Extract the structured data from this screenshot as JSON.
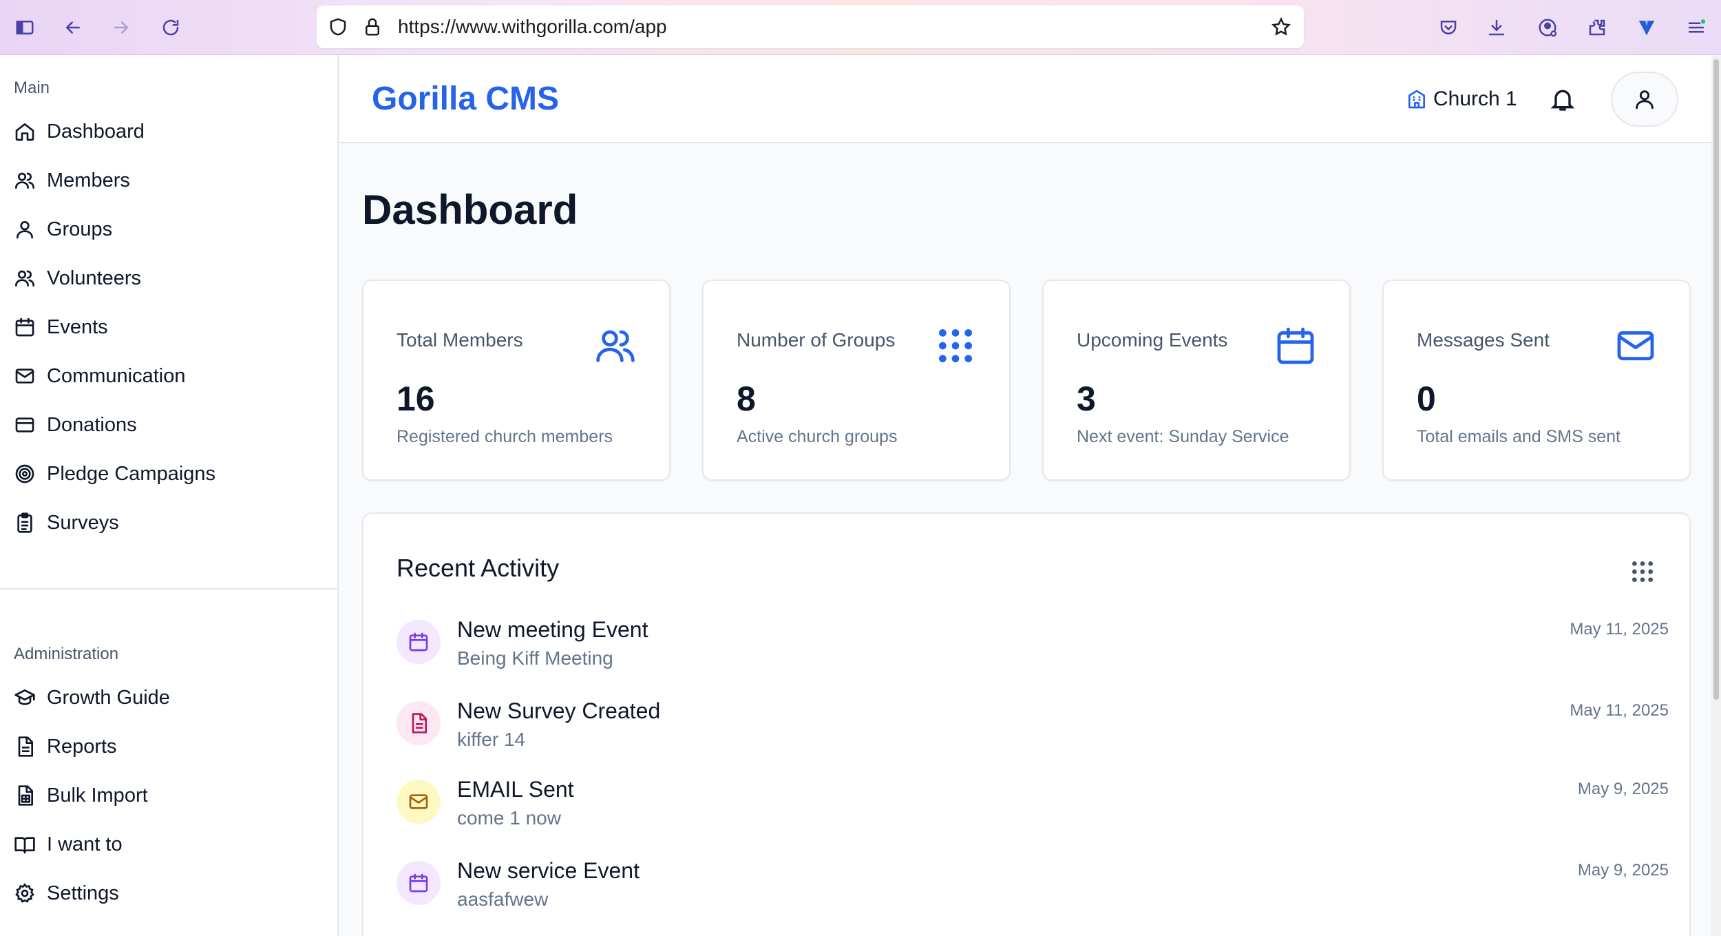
{
  "browser": {
    "url": "https://www.withgorilla.com/app"
  },
  "sidebar": {
    "main_label": "Main",
    "main_items": [
      {
        "label": "Dashboard",
        "icon": "home-icon"
      },
      {
        "label": "Members",
        "icon": "users-icon"
      },
      {
        "label": "Groups",
        "icon": "user-icon"
      },
      {
        "label": "Volunteers",
        "icon": "users-icon"
      },
      {
        "label": "Events",
        "icon": "calendar-icon"
      },
      {
        "label": "Communication",
        "icon": "mail-icon"
      },
      {
        "label": "Donations",
        "icon": "credit-card-icon"
      },
      {
        "label": "Pledge Campaigns",
        "icon": "target-icon"
      },
      {
        "label": "Surveys",
        "icon": "clipboard-icon"
      }
    ],
    "admin_label": "Administration",
    "admin_items": [
      {
        "label": "Growth Guide",
        "icon": "graduation-cap-icon"
      },
      {
        "label": "Reports",
        "icon": "file-text-icon"
      },
      {
        "label": "Bulk Import",
        "icon": "file-spreadsheet-icon"
      },
      {
        "label": "I want to",
        "icon": "book-open-icon"
      },
      {
        "label": "Settings",
        "icon": "gear-icon"
      }
    ]
  },
  "header": {
    "brand": "Gorilla CMS",
    "church": "Church 1"
  },
  "main": {
    "title": "Dashboard",
    "cards": [
      {
        "title": "Total Members",
        "value": "16",
        "sub": "Registered church members",
        "icon": "users-icon"
      },
      {
        "title": "Number of Groups",
        "value": "8",
        "sub": "Active church groups",
        "icon": "grid-dots-icon"
      },
      {
        "title": "Upcoming Events",
        "value": "3",
        "sub": "Next event: Sunday Service",
        "icon": "calendar-icon"
      },
      {
        "title": "Messages Sent",
        "value": "0",
        "sub": "Total emails and SMS sent",
        "icon": "mail-icon"
      }
    ],
    "activity": {
      "title": "Recent Activity",
      "items": [
        {
          "title": "New meeting Event",
          "sub": "Being Kiff Meeting",
          "date": "May 11, 2025",
          "icon": "calendar-icon",
          "color": "#7c3aed",
          "bg": "#f3e8ff"
        },
        {
          "title": "New Survey Created",
          "sub": "kiffer 14",
          "date": "May 11, 2025",
          "icon": "file-text-icon",
          "color": "#be185d",
          "bg": "#fce7f3"
        },
        {
          "title": "EMAIL Sent",
          "sub": "come 1 now",
          "date": "May 9, 2025",
          "icon": "mail-icon",
          "color": "#a16207",
          "bg": "#fef9c3"
        },
        {
          "title": "New service Event",
          "sub": "aasfafwew",
          "date": "May 9, 2025",
          "icon": "calendar-icon",
          "color": "#7c3aed",
          "bg": "#f3e8ff"
        }
      ]
    }
  },
  "colors": {
    "accent": "#2563eb"
  }
}
